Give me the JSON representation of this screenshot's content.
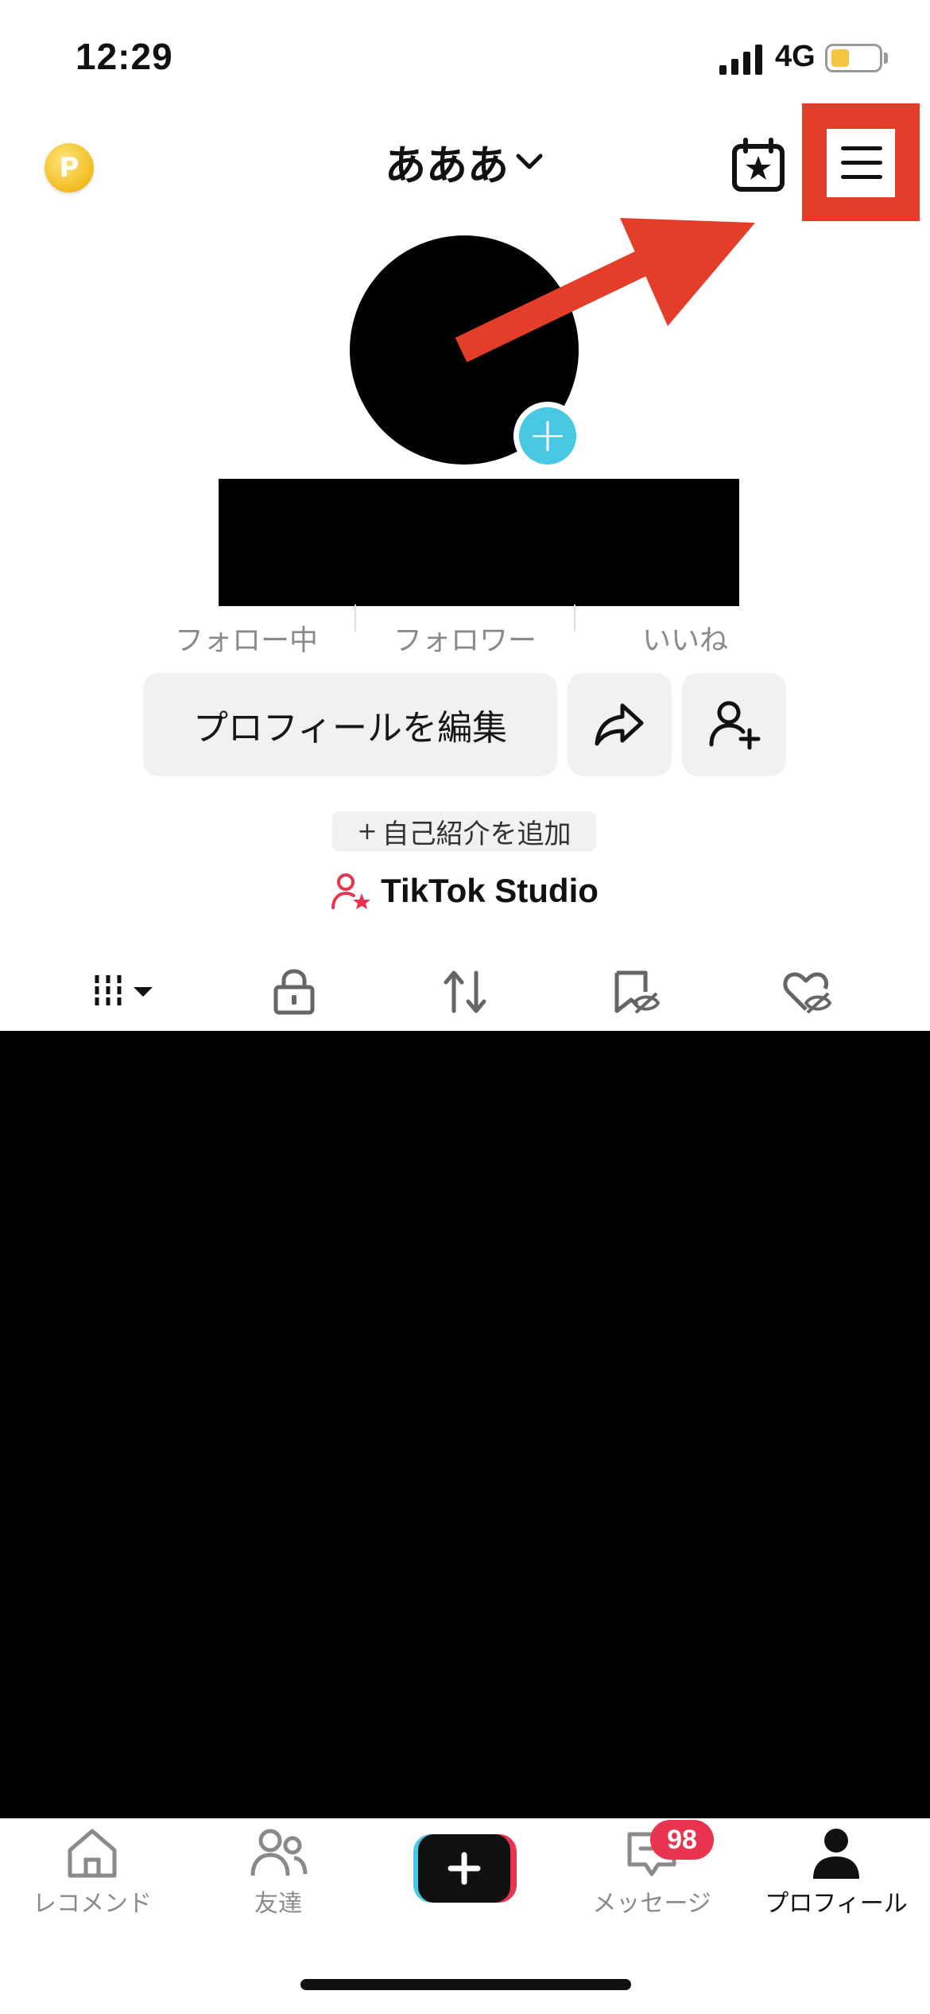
{
  "status_bar": {
    "time": "12:29",
    "network": "4G"
  },
  "header": {
    "coin_icon": "coin-icon",
    "coin_letter": "P",
    "username": "あああ",
    "chevron": "⌄"
  },
  "stats": {
    "following_label": "フォロー中",
    "followers_label": "フォロワー",
    "likes_label": "いいね"
  },
  "buttons": {
    "edit_profile": "プロフィールを編集",
    "add_bio_plus": "+",
    "add_bio": "自己紹介を追加"
  },
  "studio": {
    "label": "TikTok Studio"
  },
  "tabs": [
    "videos-grid",
    "private",
    "reposts",
    "favorites-hidden",
    "liked-hidden"
  ],
  "bottom_nav": {
    "home": "レコメンド",
    "friends": "友達",
    "messages": "メッセージ",
    "messages_badge": "98",
    "profile": "プロフィール"
  },
  "colors": {
    "accent_red": "#e43e2b",
    "teal": "#49c8e3",
    "pink": "#e8344f",
    "coin_gold": "#f4c22e"
  }
}
